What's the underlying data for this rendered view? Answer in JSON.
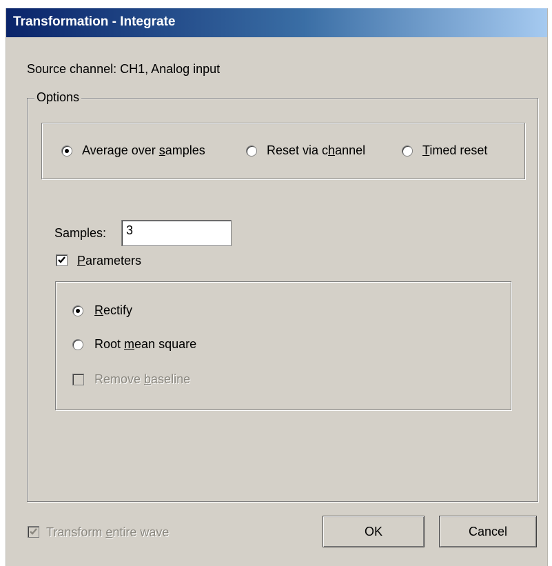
{
  "window": {
    "title": "Transformation - Integrate"
  },
  "source": {
    "text": "Source channel:  CH1, Analog input"
  },
  "options": {
    "legend": "Options",
    "modes": [
      {
        "pre": "Average over ",
        "acc": "s",
        "post": "amples",
        "selected": true
      },
      {
        "pre": "Reset via c",
        "acc": "h",
        "post": "annel",
        "selected": false
      },
      {
        "pre": "",
        "acc": "T",
        "post": "imed reset",
        "selected": false
      }
    ],
    "samples_label": "Samples:",
    "samples_value": "3",
    "parameters": {
      "pre": "",
      "acc": "P",
      "post": "arameters",
      "checked": true
    },
    "params": {
      "rectify": {
        "pre": "",
        "acc": "R",
        "post": "ectify",
        "selected": true
      },
      "rms": {
        "pre": "Root ",
        "acc": "m",
        "post": "ean square",
        "selected": false
      },
      "remove_baseline": {
        "pre": "Remove ",
        "acc": "b",
        "post": "aseline",
        "checked": false,
        "enabled": false
      }
    }
  },
  "footer": {
    "transform_entire": {
      "pre": "Transform ",
      "acc": "e",
      "post": "ntire wave",
      "checked": true,
      "enabled": false
    },
    "ok_label": "OK",
    "cancel_label": "Cancel"
  }
}
